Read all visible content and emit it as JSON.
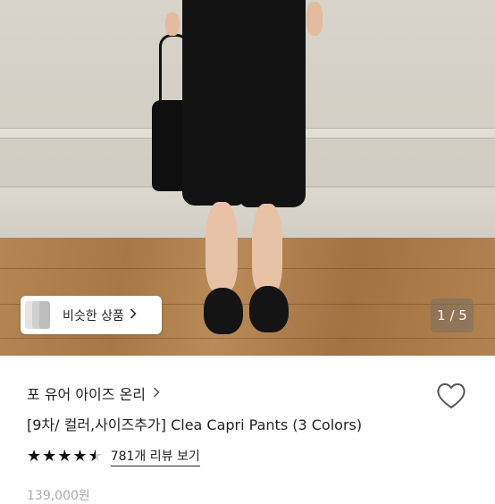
{
  "photo": {
    "similar_button_label": "비슷한 상품",
    "image_counter": "1 / 5"
  },
  "product": {
    "shop_name": "포 유어 아이즈 온리",
    "title": "[9차/ 컬러,사이즈추가] Clea Capri Pants (3 Colors)",
    "rating": 4.5,
    "reviews_label": "781개 리뷰 보기",
    "price": "139,000원"
  },
  "icons": {
    "shop_chevron": "chevron-right-icon",
    "similar_chevron": "chevron-right-icon",
    "favorite": "heart-outline-icon",
    "star": "star-icon"
  },
  "colors": {
    "text": "#222222",
    "price_muted": "#aaaaaa",
    "counter_bg": "#787064"
  }
}
